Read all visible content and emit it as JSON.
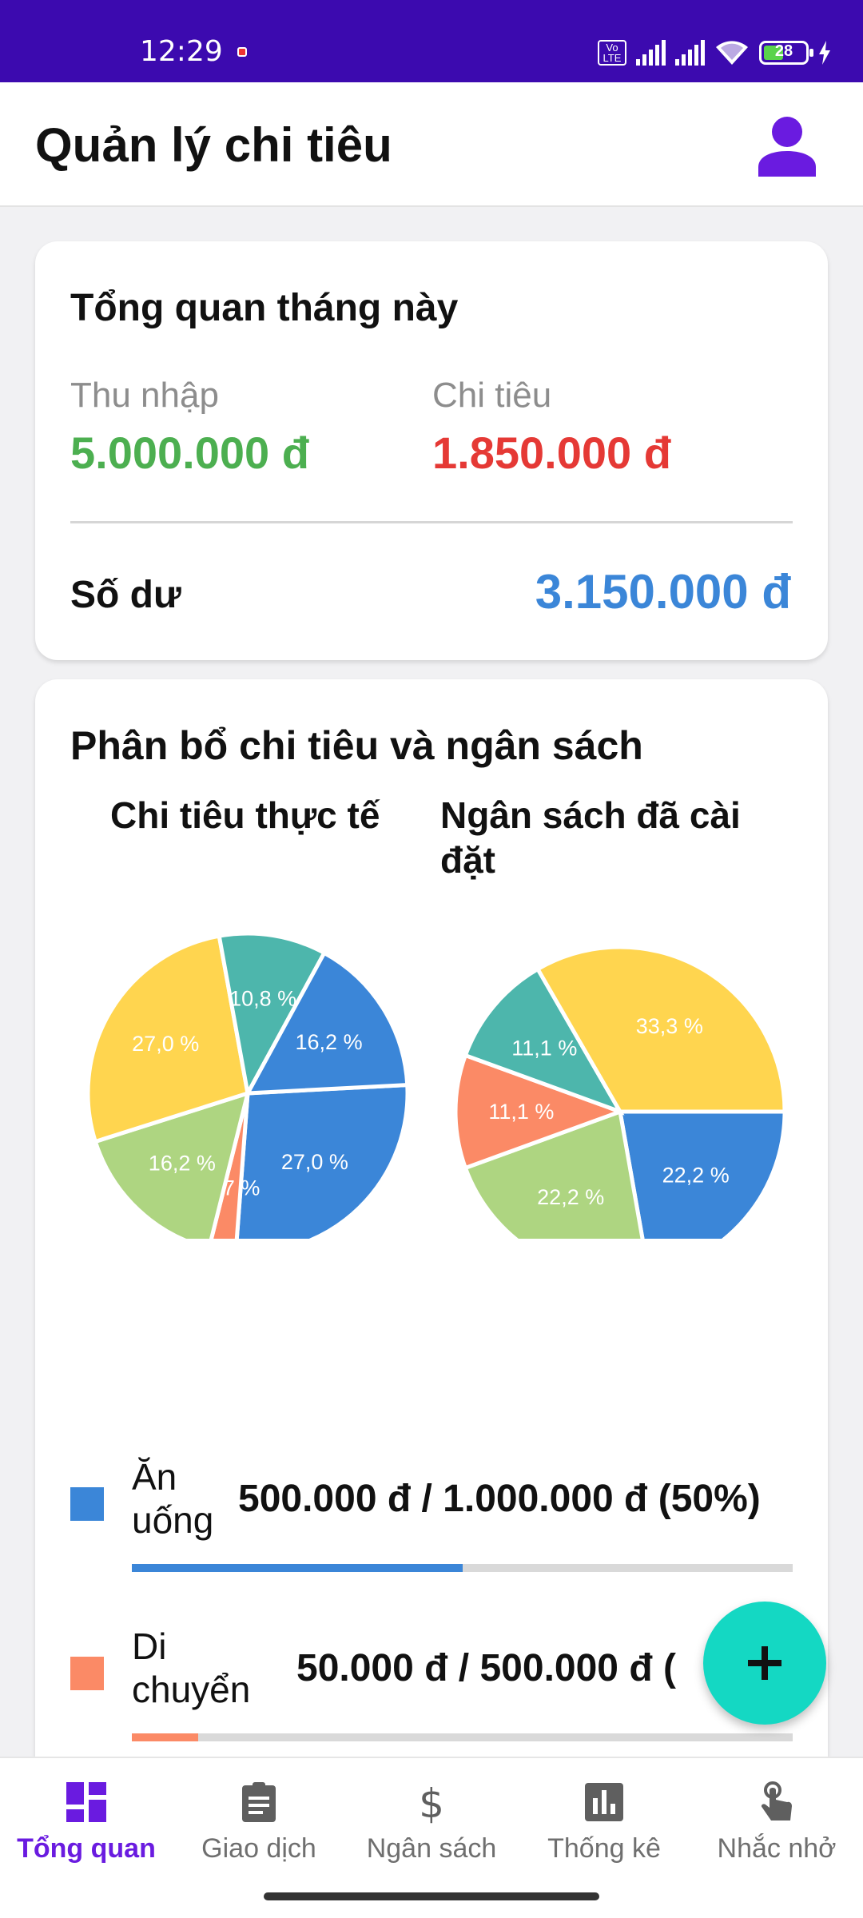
{
  "status_bar": {
    "time": "12:29",
    "volte": "Vo LTE",
    "battery": "28"
  },
  "app_bar": {
    "title": "Quản lý chi tiêu",
    "profile_icon": "person-icon"
  },
  "overview": {
    "title": "Tổng quan tháng này",
    "income_label": "Thu nhập",
    "income_value": "5.000.000 đ",
    "expense_label": "Chi tiêu",
    "expense_value": "1.850.000 đ",
    "balance_label": "Số dư",
    "balance_value": "3.150.000 đ",
    "colors": {
      "income": "#4caf50",
      "expense": "#e53935",
      "balance": "#3b86d8"
    }
  },
  "distribution": {
    "title": "Phân bổ chi tiêu và ngân sách",
    "actual_title": "Chi tiêu thực tế",
    "budget_title_line1": "Ngân sách đã cài",
    "budget_title_line2": "đặt"
  },
  "chart_data": [
    {
      "type": "pie",
      "title": "Chi tiêu thực tế",
      "slices": [
        {
          "value": 27.0,
          "label": "27,0 %",
          "color": "#3b86d8"
        },
        {
          "value": 2.7,
          "label": "2,7 %",
          "color": "#fb8a66"
        },
        {
          "value": 16.2,
          "label": "16,2 %",
          "color": "#aed581"
        },
        {
          "value": 27.0,
          "label": "27,0 %",
          "color": "#ffd54f"
        },
        {
          "value": 10.8,
          "label": "10,8 %",
          "color": "#4db6ac"
        },
        {
          "value": 16.2,
          "label": "16,2 %",
          "color": "#3b86d8"
        }
      ]
    },
    {
      "type": "pie",
      "title": "Ngân sách đã cài đặt",
      "slices": [
        {
          "value": 22.2,
          "label": "22,2 %",
          "color": "#3b86d8"
        },
        {
          "value": 22.2,
          "label": "22,2 %",
          "color": "#aed581"
        },
        {
          "value": 11.1,
          "label": "11,1 %",
          "color": "#fb8a66"
        },
        {
          "value": 11.1,
          "label": "11,1 %",
          "color": "#4db6ac"
        },
        {
          "value": 33.3,
          "label": "33,3 %",
          "color": "#ffd54f"
        }
      ]
    }
  ],
  "categories": [
    {
      "name": "Ăn uống",
      "amount": "500.000 đ / 1.000.000 đ (50%)",
      "progress": 0.5,
      "color": "#3b86d8"
    },
    {
      "name": "Di chuyển",
      "amount": "50.000 đ / 500.000 đ (",
      "progress": 0.1,
      "color": "#fb8a66"
    }
  ],
  "fab": {
    "icon": "plus-icon"
  },
  "bottom_nav": [
    {
      "label": "Tổng quan",
      "icon": "dashboard-icon",
      "active": true
    },
    {
      "label": "Giao dịch",
      "icon": "clipboard-icon",
      "active": false
    },
    {
      "label": "Ngân sách",
      "icon": "dollar-icon",
      "active": false
    },
    {
      "label": "Thống kê",
      "icon": "bar-chart-icon",
      "active": false
    },
    {
      "label": "Nhắc nhở",
      "icon": "touch-icon",
      "active": false
    }
  ]
}
